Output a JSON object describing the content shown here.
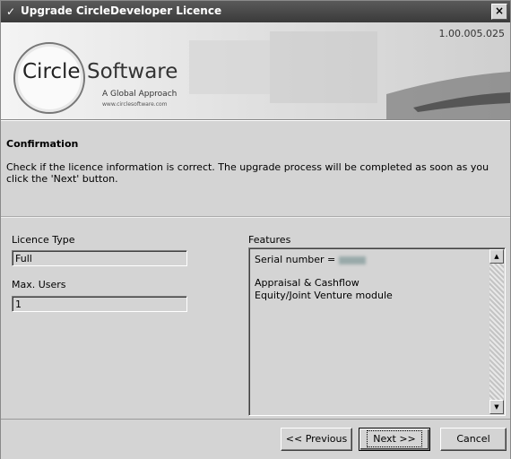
{
  "window": {
    "title": "Upgrade CircleDeveloper Licence",
    "close_glyph": "×"
  },
  "banner": {
    "version": "1.00.005.025",
    "logo_circle": "Circle",
    "logo_software": "Software",
    "logo_tagline": "A Global Approach",
    "logo_url": "www.circlesoftware.com"
  },
  "confirmation": {
    "title": "Confirmation",
    "text": "Check if the licence information is correct. The upgrade process will be completed as soon as you click the 'Next' button."
  },
  "licence": {
    "type_label": "Licence Type",
    "type_value": "Full",
    "users_label": "Max. Users",
    "users_value": "1"
  },
  "features": {
    "label": "Features",
    "serial_prefix": "Serial number =",
    "items": [
      "Appraisal & Cashflow",
      "Equity/Joint Venture module"
    ]
  },
  "buttons": {
    "previous": "<< Previous",
    "next": "Next >>",
    "cancel": "Cancel"
  },
  "icons": {
    "title_icon": "wand-icon",
    "scroll_up": "scroll-up-arrow-icon",
    "scroll_down": "scroll-down-arrow-icon"
  }
}
